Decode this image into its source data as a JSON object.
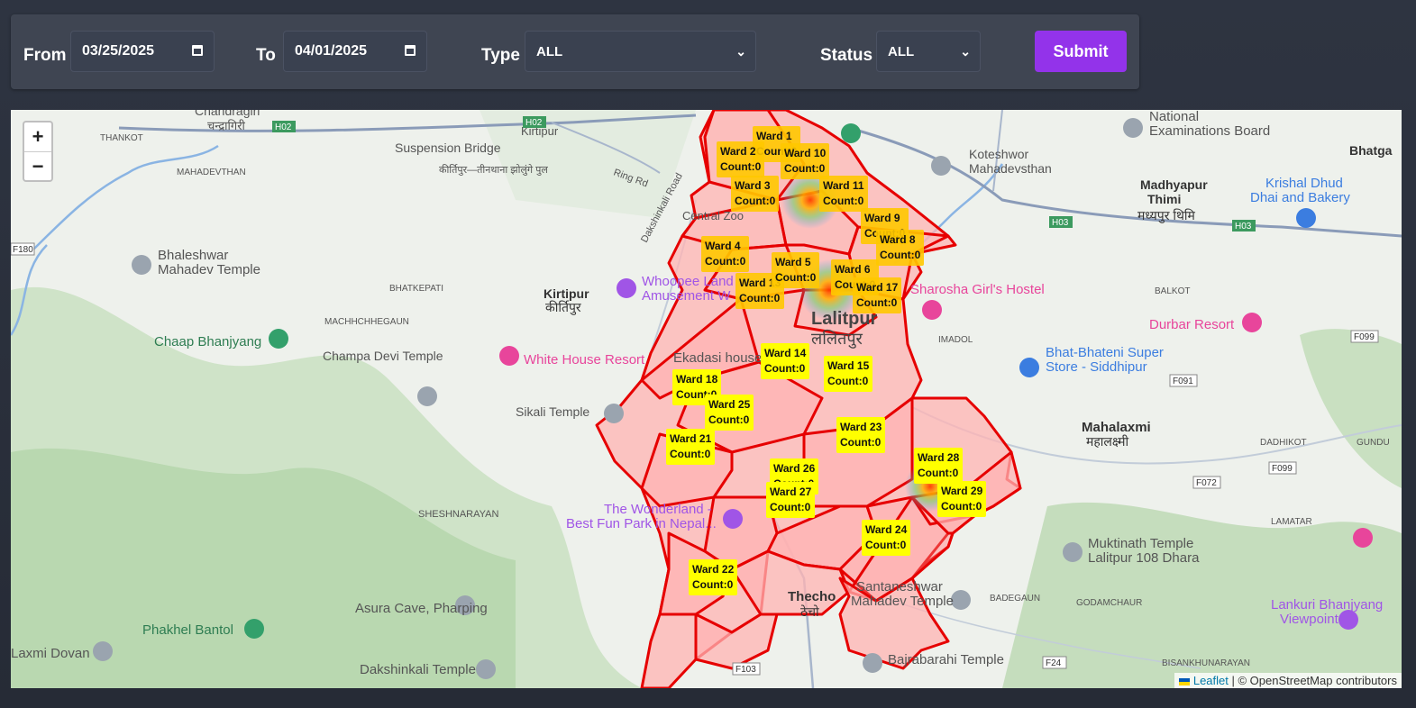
{
  "filters": {
    "from_label": "From",
    "from_value": "03/25/2025",
    "to_label": "To",
    "to_value": "04/01/2025",
    "type_label": "Type",
    "type_value": "ALL",
    "status_label": "Status",
    "status_value": "ALL",
    "submit_label": "Submit"
  },
  "zoom": {
    "in": "+",
    "out": "−"
  },
  "attribution": {
    "leaflet": "Leaflet",
    "rest": " | © OpenStreetMap contributors"
  },
  "colors": {
    "ward_border": "#e60000",
    "ward_fill": "#ffb3b3",
    "label_bg": "#ffff00",
    "submit_bg": "#9333ea"
  },
  "wards": [
    {
      "name": "Ward 1",
      "count": "Count:0"
    },
    {
      "name": "Ward 2",
      "count": "Count:0"
    },
    {
      "name": "Ward 10",
      "count": "Count:0"
    },
    {
      "name": "Ward 3",
      "count": "Count:0"
    },
    {
      "name": "Ward 11",
      "count": "Count:0"
    },
    {
      "name": "Ward 9",
      "count": "Count:0"
    },
    {
      "name": "Ward 4",
      "count": "Count:0"
    },
    {
      "name": "Ward 13",
      "count": "Count:0"
    },
    {
      "name": "Ward 5",
      "count": "Count:0"
    },
    {
      "name": "Ward 6",
      "count": "Count:0"
    },
    {
      "name": "Ward 17",
      "count": "Count:0"
    },
    {
      "name": "Ward 8",
      "count": "Count:0"
    },
    {
      "name": "Ward 14",
      "count": "Count:0"
    },
    {
      "name": "Ward 15",
      "count": "Count:0"
    },
    {
      "name": "Ward 18",
      "count": "Count:0"
    },
    {
      "name": "Ward 25",
      "count": "Count:0"
    },
    {
      "name": "Ward 21",
      "count": "Count:0"
    },
    {
      "name": "Ward 23",
      "count": "Count:0"
    },
    {
      "name": "Ward 26",
      "count": "Count:0"
    },
    {
      "name": "Ward 27",
      "count": "Count:0"
    },
    {
      "name": "Ward 28",
      "count": "Count:0"
    },
    {
      "name": "Ward 29",
      "count": "Count:0"
    },
    {
      "name": "Ward 24",
      "count": "Count:0"
    },
    {
      "name": "Ward 22",
      "count": "Count:0"
    }
  ],
  "map_labels": {
    "chandragiri": "Chandragiri",
    "chandragiri_ne": "चन्द्रागिरी",
    "suspension": "Suspension Bridge",
    "suspension_ne": "कीर्तिपुर—तीनथाना झोलुंगे पुल",
    "kirtipur": "Kirtipur",
    "kirtipur_ne": "कीर्तिपुर",
    "koteshwor": "Koteshwor",
    "koteshwor2": "Mahadevsthan",
    "national_exam": "National",
    "national_exam2": "Examinations Board",
    "madhyapur": "Madhyapur",
    "madhyapur2": "Thimi",
    "madhyapur_ne": "मध्यपुर थिमि",
    "krishal": "Krishal Dhud",
    "krishal2": "Dhai and Bakery",
    "bhaleshwar": "Bhaleshwar",
    "bhaleshwar2": "Mahadev Temple",
    "chaap": "Chaap Bhanjyang",
    "champa": "Champa Devi Temple",
    "whitehouse": "White House Resort",
    "whoopee": "Whoopee Land",
    "whoopee2": "Amusement W",
    "sikali": "Sikali Temple",
    "lalitpur": "Lalitpur",
    "lalitpur_ne": "ललितपुर",
    "ekadasi": "Ekadasi house",
    "sharosha": "Sharosha Girl's Hostel",
    "durbar": "Durbar Resort",
    "bhatbhateni": "Bhat-Bhateni Super",
    "bhatbhateni2": "Store - Siddhipur",
    "mahalaxmi": "Mahalaxmi",
    "mahalaxmi_ne": "महालक्ष्मी",
    "wonderland": "The Wonderland -",
    "wonderland2": "Best Fun Park in Nepal...",
    "shesh": "SHESHNARAYAN",
    "muktinath": "Muktinath Temple",
    "muktinath2": "Lalitpur 108 Dhara",
    "asura": "Asura Cave, Pharping",
    "phakhel": "Phakhel Bantol",
    "laxmi": "Laxmi Dovan",
    "dakshinkali": "Dakshinkali Temple",
    "thecho": "Thecho",
    "thecho_ne": "ठेचो",
    "santaneshwar": "Santaneshwar",
    "santaneshwar2": "Mahadev Temple",
    "bajrabarahi": "Bajrabarahi Temple",
    "lankuri": "Lankuri Bhanjyang",
    "lankuri2": "Viewpoint",
    "thankot": "THANKOT",
    "mahadevthan": "MAHADEVTHAN",
    "bhatkepati": "BHATKEPATI",
    "machhegaun": "MACHHCHHEGAUN",
    "balkot": "BALKOT",
    "imadol": "IMADOL",
    "dadhikot": "DADHIKOT",
    "lamatar": "LAMATAR",
    "godamchaur": "GODAMCHAUR",
    "badegaun": "BADEGAUN",
    "bisankhu": "BISANKHUNARAYAN",
    "bhatgaon": "Bhatga",
    "gundu": "GUNDU",
    "central_zoo": "Central Zoo",
    "dakshinkali_rd": "Dakshinkali Road",
    "ringrd": "Ring Rd",
    "h02": "H02",
    "h03": "H03",
    "f180": "F180",
    "f099": "F099",
    "f091": "F091",
    "f072": "F072",
    "f103": "F103",
    "f24": "F24",
    "f099b": "F099"
  }
}
